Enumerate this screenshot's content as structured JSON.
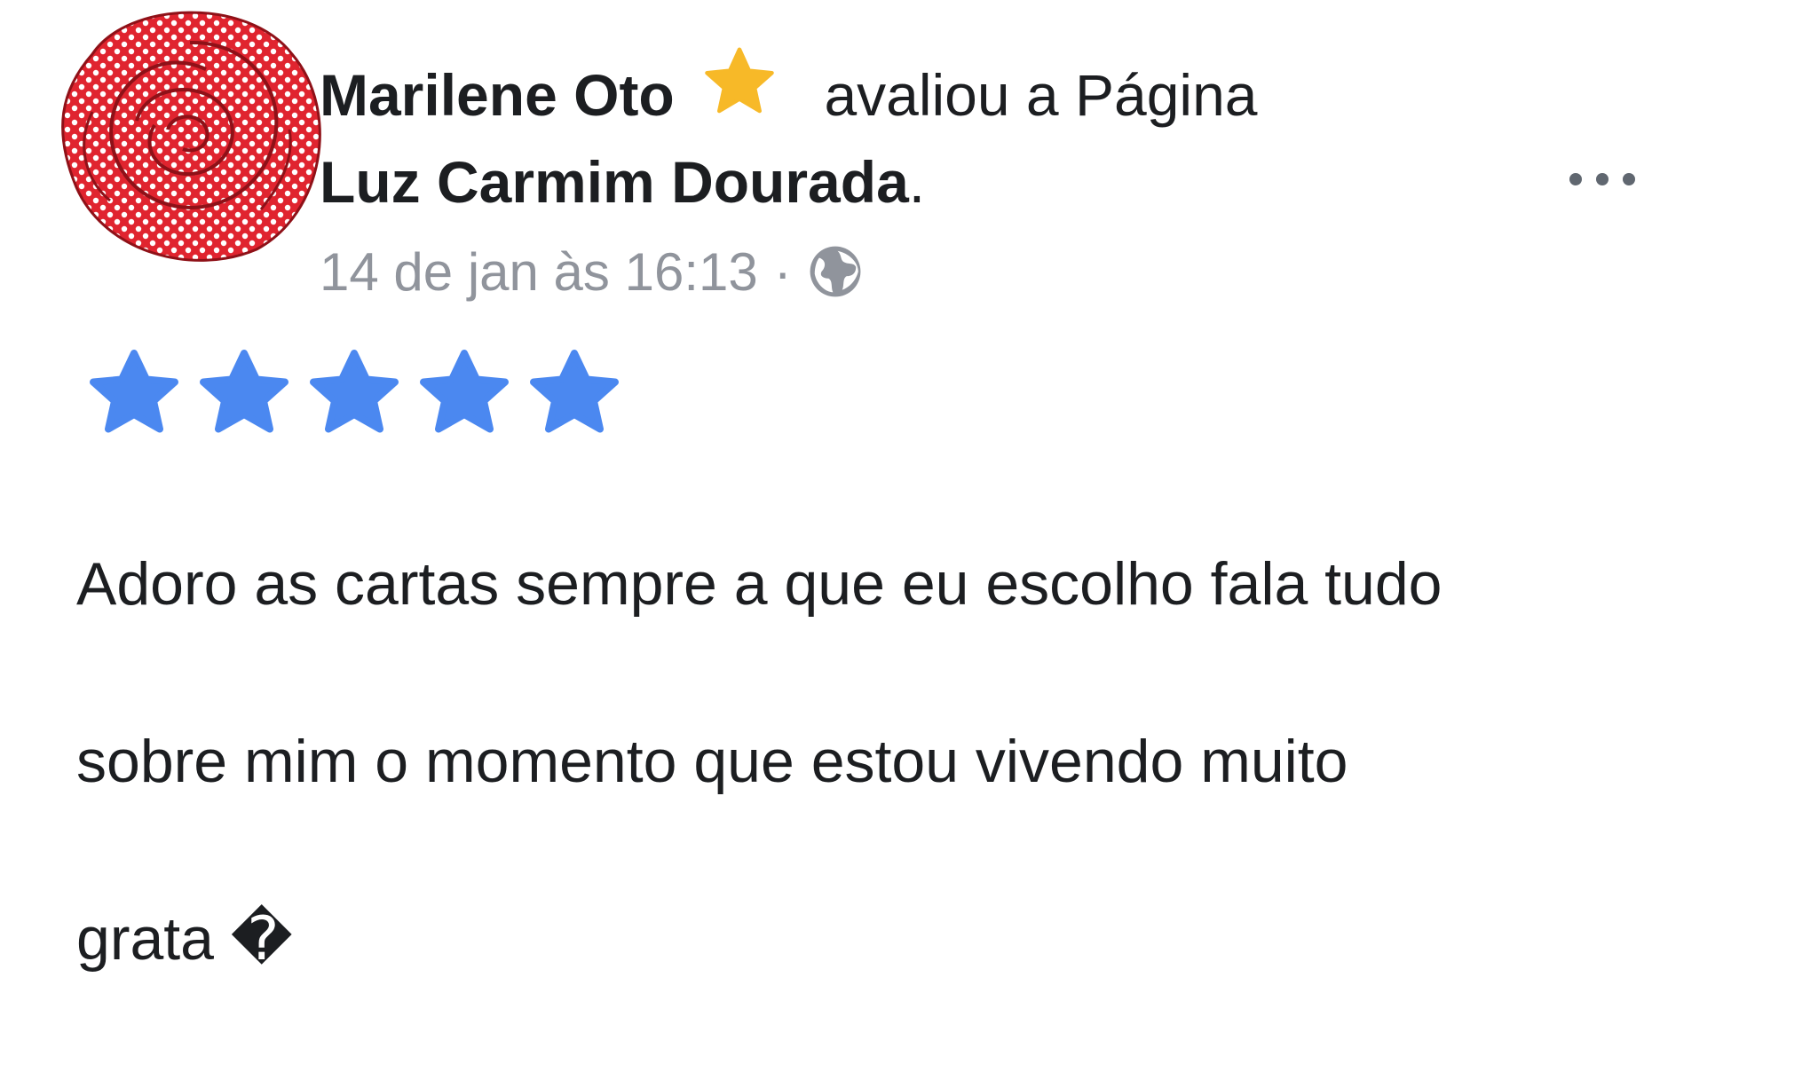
{
  "review": {
    "author": "Marilene Oto",
    "action": "avaliou a Página",
    "page_name": "Luz Carmim Dourada",
    "period": ".",
    "timestamp": "14 de jan às 16:13",
    "separator": "·",
    "privacy_icon": "globe-icon",
    "badge_icon": "star-icon",
    "more_icon": "more-horizontal-icon",
    "rating": 5,
    "rating_max": 5,
    "text_line1": "Adoro as cartas sempre a que eu escolho fala tudo",
    "text_line2": "sobre mim o momento que estou vivendo muito",
    "text_line3": "grata �"
  },
  "colors": {
    "rating_star": "#4b88f0",
    "badge_star": "#f7b928",
    "avatar_rose": "#e0242f",
    "meta_text": "#90949c",
    "main_text": "#1c1e21"
  }
}
